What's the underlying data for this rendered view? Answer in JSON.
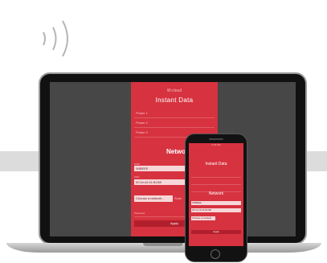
{
  "laptop_app": {
    "logo": "W-cloud",
    "title": "Instant Data",
    "rows": [
      "Phase 1",
      "Phase 2",
      "Phase 3"
    ],
    "network_heading": "Network",
    "ssid_label": "SSID",
    "ssid_value": "WIBEEE",
    "mac_label": "MAC",
    "mac_value": "00:1e:c0:11:81:88",
    "select_label": "Choose a network...",
    "select_side": "Scan",
    "password_label": "Password",
    "apply_label": "Apply"
  },
  "phone_app": {
    "status": "9:41 AM",
    "title": "Instant Data",
    "network_heading": "Network",
    "ssid_value": "WIBEEE",
    "mac_value": "00:1e:c0:11:81:88",
    "select_label": "Choose a network",
    "apply_label": "Apply"
  },
  "colors": {
    "brand": "#d7323f",
    "field": "#f7d6d8",
    "button": "#b21f2c"
  }
}
